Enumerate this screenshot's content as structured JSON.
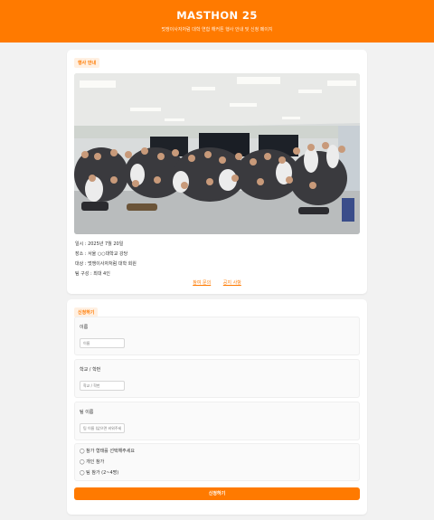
{
  "header": {
    "title": "MASTHON 25",
    "subtitle": "멋쟁이사자처럼 대학 연합 해커톤 행사 안내 및 신청 페이지"
  },
  "event_card": {
    "tag": "행사 안내",
    "info": [
      "일시 : 2025년 7월 20일",
      "장소 : 서울 ○○대학교 강당",
      "대상 : 멋쟁이사자처럼 대학 회원",
      "팀 구성 : 최대 4인"
    ],
    "links": [
      "참여 문의",
      "공지 사항"
    ]
  },
  "form_card": {
    "tag": "신청하기",
    "name_label": "이름",
    "name_placeholder": "이름",
    "school_label": "학교 / 학번",
    "school_placeholder": "학교 / 학번",
    "team_label": "팀 이름",
    "team_placeholder": "팀 이름 (없으면 비워주세요)",
    "radio_question": "◯ 참가 형태를 선택해주세요",
    "radio_options": [
      "◯ 개인 참가",
      "◯ 팀 참가 (2~4명)"
    ],
    "submit_label": "신청하기"
  },
  "colors": {
    "accent": "#ff7a00",
    "background": "#f2f2f2"
  }
}
